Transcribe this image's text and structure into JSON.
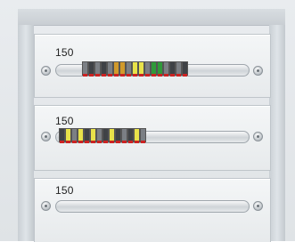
{
  "rows": [
    {
      "label": "150"
    },
    {
      "label": "150"
    },
    {
      "label": "150"
    }
  ],
  "colors": {
    "gray": "#7b7f84",
    "dark": "#3f4246",
    "orange": "#d19a2b",
    "yellow": "#e8e24a",
    "green": "#2f9a3a",
    "red": "#cc2222"
  }
}
